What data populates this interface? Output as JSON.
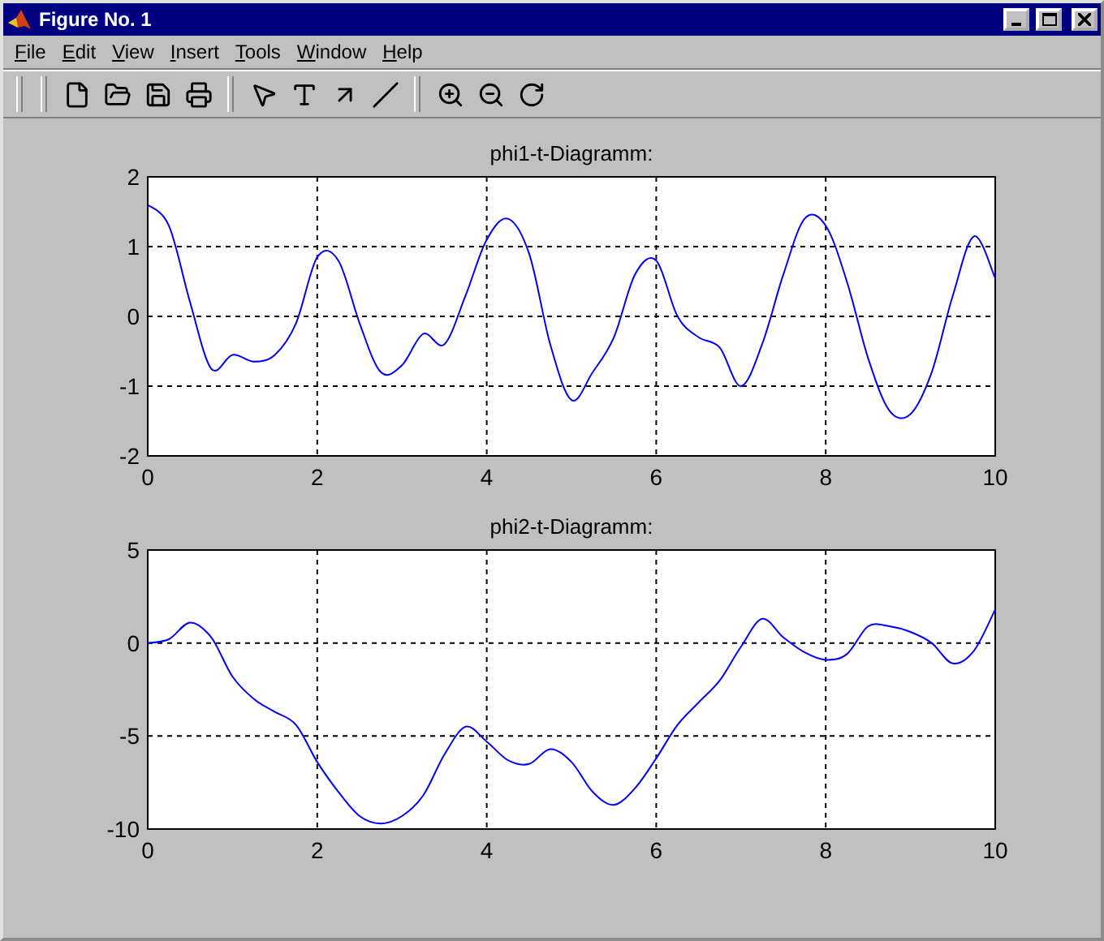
{
  "window": {
    "title": "Figure No. 1"
  },
  "menu": [
    "File",
    "Edit",
    "View",
    "Insert",
    "Tools",
    "Window",
    "Help"
  ],
  "plots": [
    {
      "chart_data": {
        "type": "line",
        "title": "phi1-t-Diagramm:",
        "x": [
          0,
          0.25,
          0.5,
          0.75,
          1,
          1.25,
          1.5,
          1.75,
          2,
          2.25,
          2.5,
          2.75,
          3,
          3.25,
          3.5,
          3.75,
          4,
          4.25,
          4.5,
          4.75,
          5,
          5.25,
          5.5,
          5.75,
          6,
          6.25,
          6.5,
          6.75,
          7,
          7.25,
          7.5,
          7.75,
          8,
          8.25,
          8.5,
          8.75,
          9,
          9.25,
          9.5,
          9.75,
          10
        ],
        "series": [
          {
            "color": "#0000ff",
            "values": [
              1.6,
              1.3,
              0.2,
              -0.75,
              -0.55,
              -0.65,
              -0.55,
              -0.1,
              0.85,
              0.8,
              -0.1,
              -0.8,
              -0.7,
              -0.25,
              -0.4,
              0.3,
              1.1,
              1.4,
              0.9,
              -0.4,
              -1.2,
              -0.8,
              -0.3,
              0.6,
              0.8,
              0.0,
              -0.3,
              -0.45,
              -1.0,
              -0.4,
              0.6,
              1.4,
              1.3,
              0.5,
              -0.6,
              -1.35,
              -1.4,
              -0.8,
              0.3,
              1.15,
              0.55
            ]
          }
        ],
        "xlim": [
          0,
          10
        ],
        "ylim": [
          -2,
          2
        ],
        "xticks": [
          0,
          2,
          4,
          6,
          8,
          10
        ],
        "yticks": [
          -2,
          -1,
          0,
          1,
          2
        ],
        "grid": true
      }
    },
    {
      "chart_data": {
        "type": "line",
        "title": "phi2-t-Diagramm:",
        "x": [
          0,
          0.25,
          0.5,
          0.75,
          1,
          1.25,
          1.5,
          1.75,
          2,
          2.25,
          2.5,
          2.75,
          3,
          3.25,
          3.5,
          3.75,
          4,
          4.25,
          4.5,
          4.75,
          5,
          5.25,
          5.5,
          5.75,
          6,
          6.25,
          6.5,
          6.75,
          7,
          7.25,
          7.5,
          7.75,
          8,
          8.25,
          8.5,
          8.75,
          9,
          9.25,
          9.5,
          9.75,
          10
        ],
        "series": [
          {
            "color": "#0000ff",
            "values": [
              0,
              0.2,
              1.1,
              0.3,
              -1.8,
              -3.0,
              -3.7,
              -4.4,
              -6.4,
              -8.0,
              -9.3,
              -9.7,
              -9.3,
              -8.2,
              -6.0,
              -4.5,
              -5.3,
              -6.3,
              -6.5,
              -5.7,
              -6.4,
              -8.0,
              -8.7,
              -7.8,
              -6.2,
              -4.4,
              -3.2,
              -2.0,
              -0.2,
              1.3,
              0.3,
              -0.5,
              -0.9,
              -0.6,
              0.9,
              0.9,
              0.6,
              0.0,
              -1.1,
              -0.4,
              1.8
            ]
          }
        ],
        "xlim": [
          0,
          10
        ],
        "ylim": [
          -10,
          5
        ],
        "xticks": [
          0,
          2,
          4,
          6,
          8,
          10
        ],
        "yticks": [
          -10,
          -5,
          0,
          5
        ],
        "grid": true
      }
    }
  ]
}
